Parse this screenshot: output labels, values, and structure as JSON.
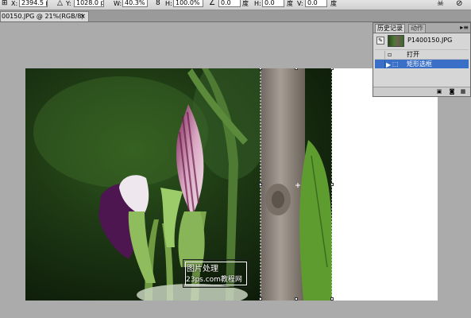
{
  "options_bar": {
    "x_label": "X:",
    "x_value": "2394.5 px",
    "y_label": "Y:",
    "y_value": "1028.0 px",
    "w_label": "W:",
    "w_value": "40.3%",
    "h_label": "H:",
    "h_value": "100.0%",
    "angle_value": "0.0",
    "angle_unit": "度",
    "hskew_label": "H:",
    "hskew_value": "0.0",
    "hskew_unit": "度",
    "vskew_label": "V:",
    "vskew_value": "0.0",
    "vskew_unit": "度"
  },
  "document_tab": {
    "title": "00150.JPG @ 21%(RGB/8)",
    "close": "×"
  },
  "history_panel": {
    "tab_history": "历史记录",
    "tab_actions": "动作",
    "snapshot_label": "P1400150.JPG",
    "items": [
      {
        "label": "打开",
        "selected": false
      },
      {
        "label": "矩形选框",
        "selected": true
      }
    ]
  },
  "watermark": {
    "line1": "图片处理",
    "line2": "23ps.com教程网"
  },
  "colors": {
    "selection_highlight": "#3a6fc8",
    "canvas_bg": "#ababab",
    "panel_bg": "#d6d6d6"
  },
  "icons": [
    "link-icon",
    "warp-icon",
    "cancel-icon",
    "close-icon",
    "panel-menu-icon"
  ]
}
